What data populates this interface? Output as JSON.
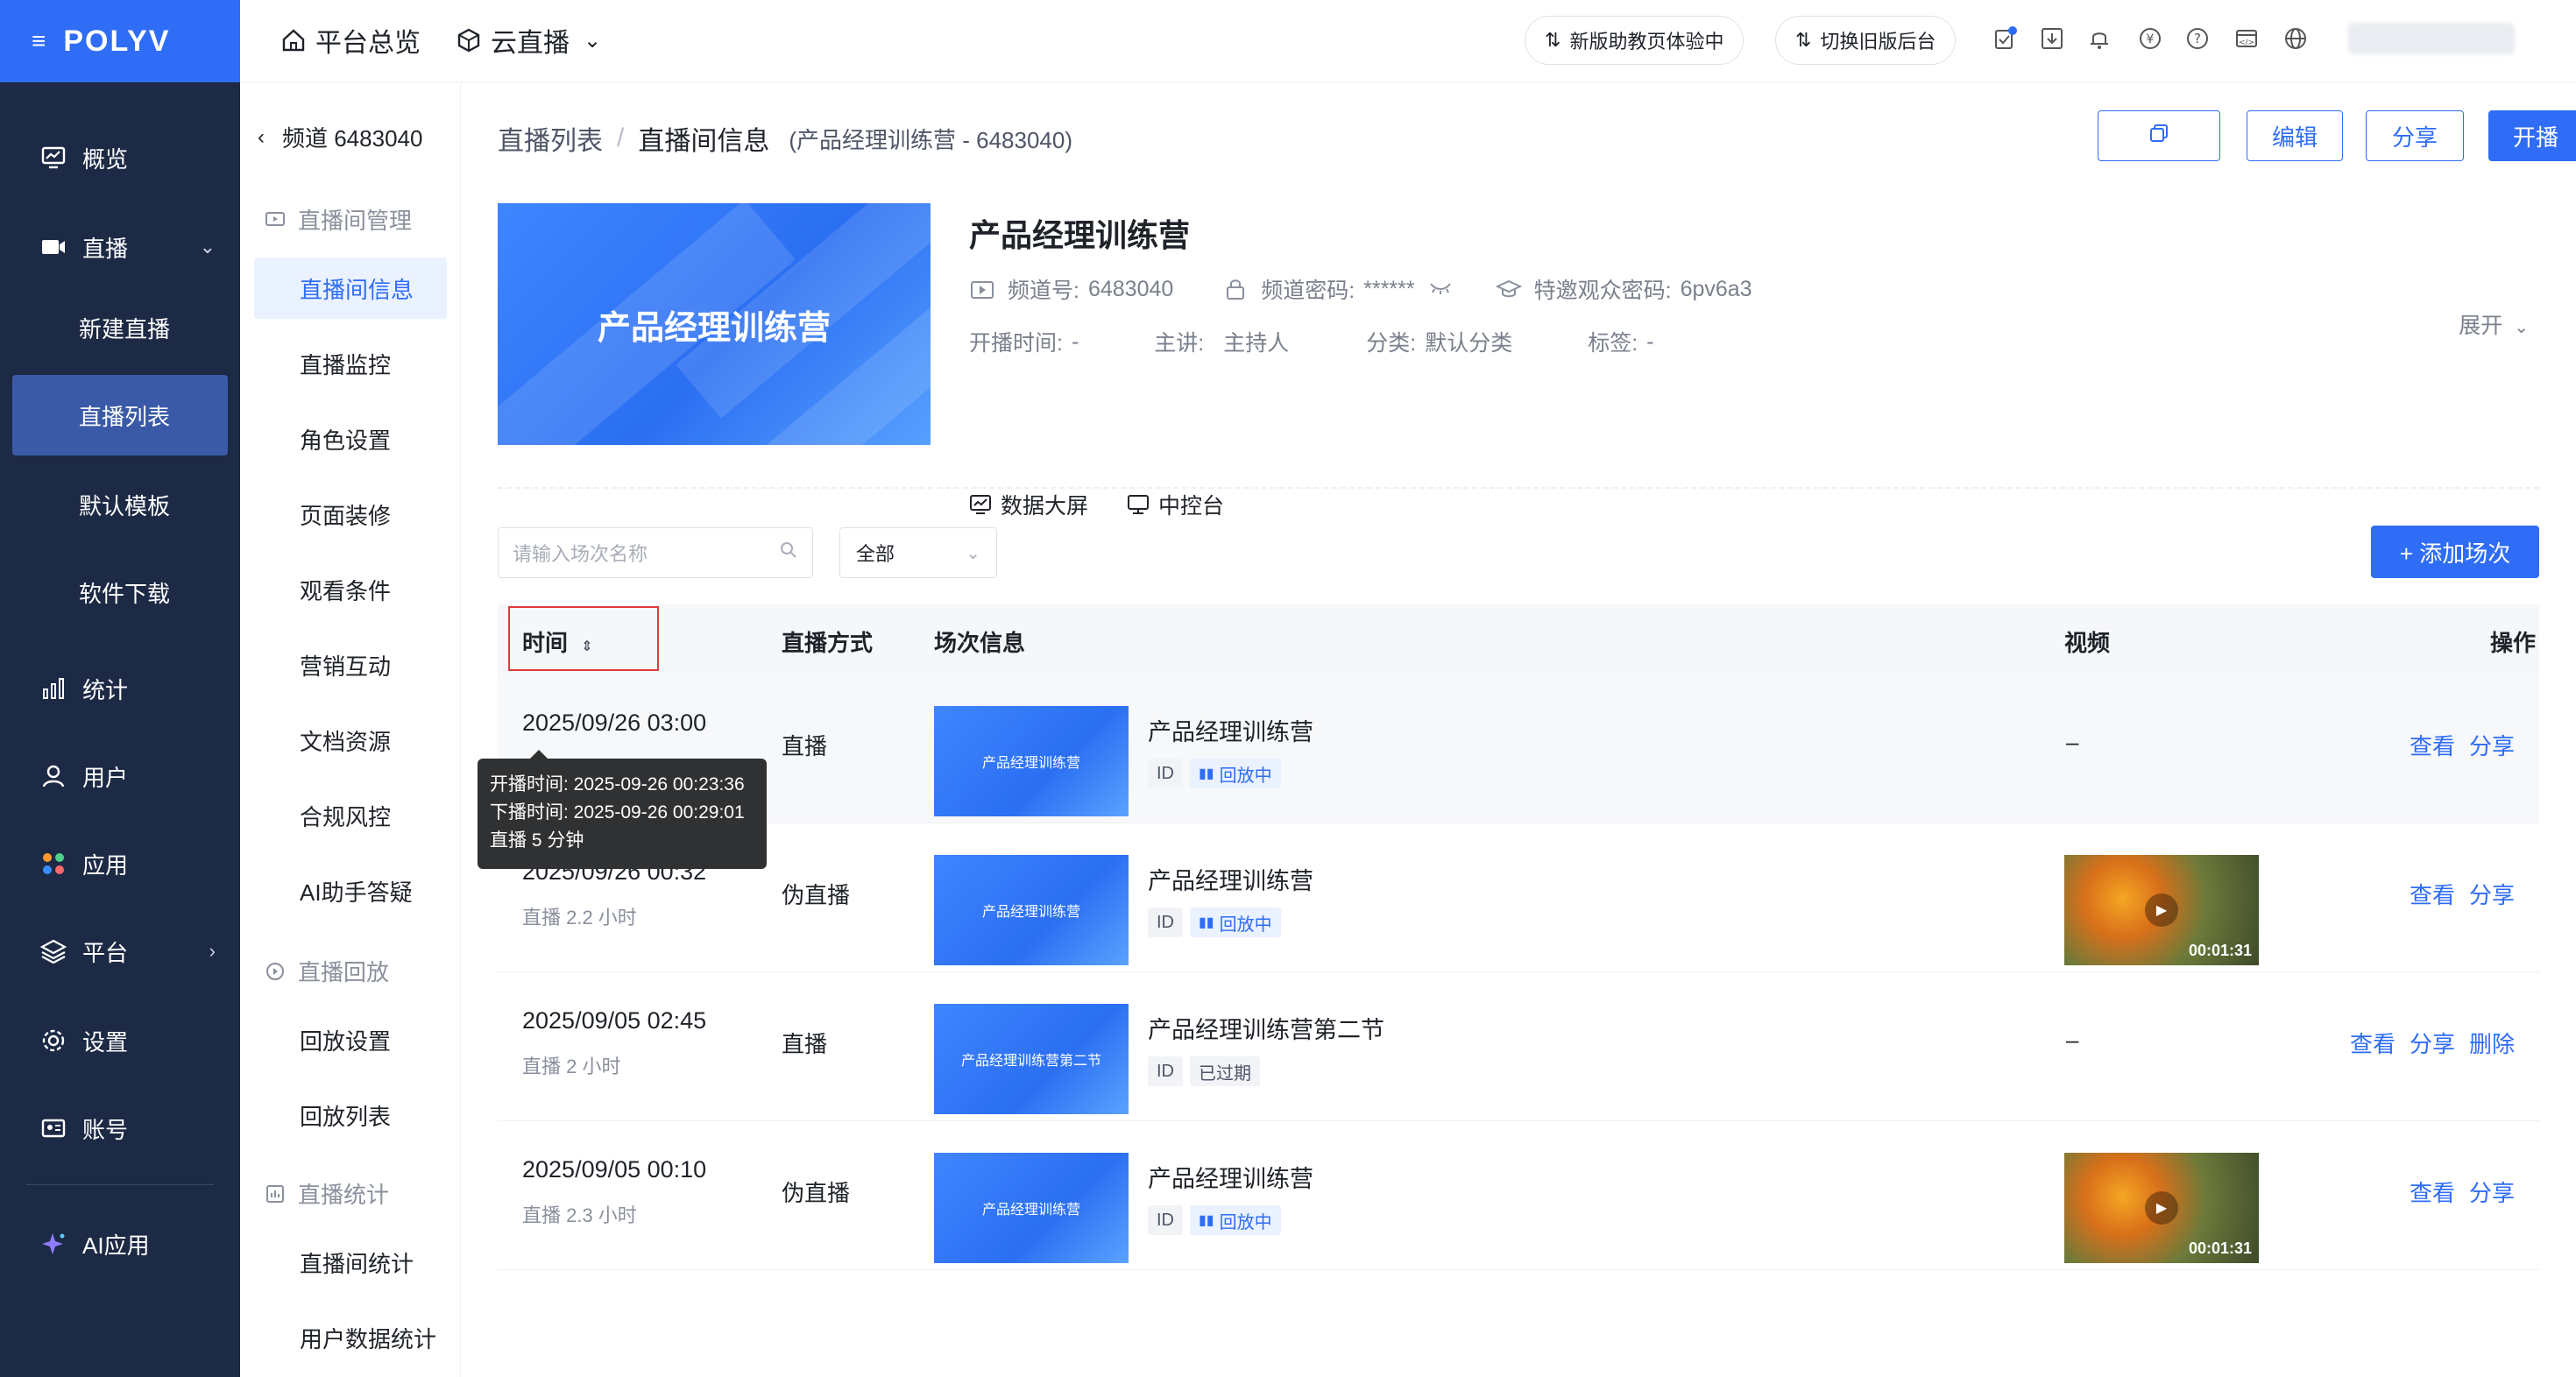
{
  "brand": {
    "name": "POLYV"
  },
  "nav": {
    "overview": "概览",
    "live": "直播",
    "live_sub": {
      "new": "新建直播",
      "list": "直播列表",
      "template": "默认模板",
      "download": "软件下载"
    },
    "stats": "统计",
    "users": "用户",
    "apps": "应用",
    "platform": "平台",
    "settings": "设置",
    "account": "账号",
    "ai": "AI应用"
  },
  "header": {
    "home": "平台总览",
    "cloud": "云直播",
    "pill_assistant": "新版助教页体验中",
    "pill_switch": "切换旧版后台"
  },
  "subnav": {
    "channel": "频道 6483040",
    "group_room": "直播间管理",
    "items_room": [
      "直播间信息",
      "直播监控",
      "角色设置",
      "页面装修",
      "观看条件",
      "营销互动",
      "文档资源",
      "合规风控",
      "AI助手答疑"
    ],
    "group_replay": "直播回放",
    "items_replay": [
      "回放设置",
      "回放列表"
    ],
    "group_stats": "直播统计",
    "items_stats": [
      "直播间统计",
      "用户数据统计"
    ]
  },
  "page": {
    "breadcrumb": {
      "parent": "直播列表",
      "current": "直播间信息",
      "extra": "(产品经理训练营 - 6483040)"
    },
    "actions": {
      "edit": "编辑",
      "share": "分享",
      "start": "开播"
    }
  },
  "room": {
    "cover_title": "产品经理训练营",
    "title": "产品经理训练营",
    "channel_no_label": "频道号:",
    "channel_no": "6483040",
    "password_label": "频道密码:",
    "password": "******",
    "invite_label": "特邀观众密码:",
    "invite": "6pv6a3",
    "start_time_label": "开播时间:",
    "start_time": "-",
    "speaker_label": "主讲:",
    "speaker": "主持人",
    "category_label": "分类:",
    "category": "默认分类",
    "tags_label": "标签:",
    "tags": "-",
    "expand": "展开",
    "tool_bigscreen": "数据大屏",
    "tool_console": "中控台"
  },
  "sessions": {
    "search_placeholder": "请输入场次名称",
    "filter_value": "全部",
    "add_button": "+ 添加场次",
    "columns": {
      "time": "时间",
      "mode": "直播方式",
      "info": "场次信息",
      "video": "视频",
      "ops": "操作"
    },
    "rows": [
      {
        "time": "2025/09/26 03:00",
        "duration": "",
        "mode": "直播",
        "thumb": "产品经理训练营",
        "name": "产品经理训练营",
        "id": "ID",
        "status": "回放中",
        "video": "–",
        "video_duration": "",
        "ops": [
          "查看",
          "分享"
        ]
      },
      {
        "time": "2025/09/26 00:32",
        "duration": "直播 2.2 小时",
        "mode": "伪直播",
        "thumb": "产品经理训练营",
        "name": "产品经理训练营",
        "id": "ID",
        "status": "回放中",
        "video": "",
        "video_duration": "00:01:31",
        "ops": [
          "查看",
          "分享"
        ]
      },
      {
        "time": "2025/09/05 02:45",
        "duration": "直播 2 小时",
        "mode": "直播",
        "thumb": "产品经理训练营第二节",
        "name": "产品经理训练营第二节",
        "id": "ID",
        "status": "已过期",
        "video": "–",
        "video_duration": "",
        "ops": [
          "查看",
          "分享",
          "删除"
        ]
      },
      {
        "time": "2025/09/05 00:10",
        "duration": "直播 2.3 小时",
        "mode": "伪直播",
        "thumb": "产品经理训练营",
        "name": "产品经理训练营",
        "id": "ID",
        "status": "回放中",
        "video": "",
        "video_duration": "00:01:31",
        "ops": [
          "查看",
          "分享"
        ]
      }
    ]
  },
  "tooltip": {
    "line1": "开播时间: 2025-09-26 00:23:36",
    "line2": "下播时间: 2025-09-26 00:29:01",
    "line3": "直播 5 分钟"
  },
  "colors": {
    "brand": "#2f6df6",
    "sidebar": "#1d2a45",
    "active_nav": "#3a5aa8",
    "highlight_box": "#e03c3c"
  }
}
